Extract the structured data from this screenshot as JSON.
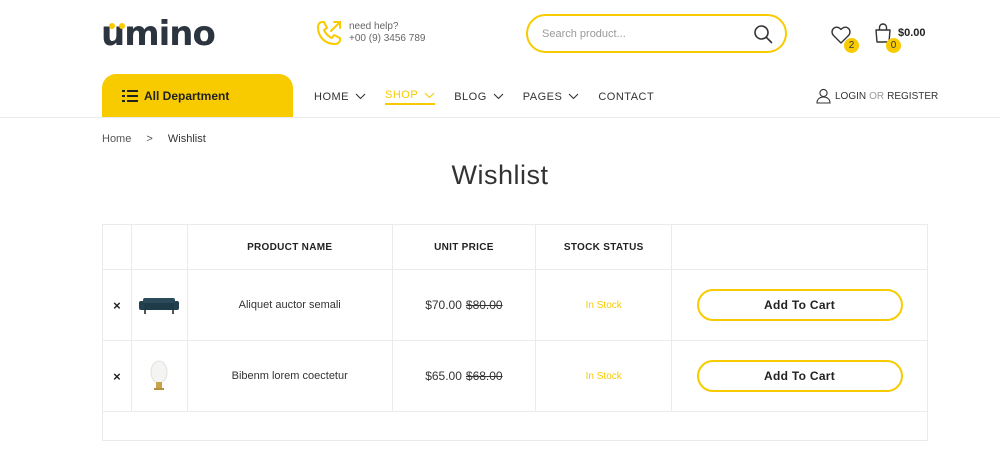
{
  "brand": {
    "logo": "umino"
  },
  "help": {
    "label": "need help?",
    "phone": "+00 (9) 3456 789"
  },
  "search": {
    "placeholder": "Search product..."
  },
  "header": {
    "wishlist_count": "2",
    "cart_count": "0",
    "cart_total": "$0.00"
  },
  "department": {
    "label": "All Department"
  },
  "nav": {
    "items": [
      {
        "label": "HOME"
      },
      {
        "label": "SHOP"
      },
      {
        "label": "BLOG"
      },
      {
        "label": "PAGES"
      },
      {
        "label": "CONTACT"
      }
    ]
  },
  "account": {
    "login": "LOGIN",
    "or": "OR",
    "register": "REGISTER"
  },
  "breadcrumb": {
    "home": "Home",
    "sep": ">",
    "current": "Wishlist"
  },
  "page": {
    "title": "Wishlist"
  },
  "table": {
    "headers": {
      "product": "PRODUCT NAME",
      "price": "UNIT PRICE",
      "stock": "STOCK STATUS"
    },
    "rows": [
      {
        "remove": "×",
        "name": "Aliquet auctor semali",
        "price": "$70.00",
        "old_price": "$80.00",
        "stock": "In Stock",
        "button": "Add To Cart",
        "thumb": "sofa"
      },
      {
        "remove": "×",
        "name": "Bibenm lorem coectetur",
        "price": "$65.00",
        "old_price": "$68.00",
        "stock": "In Stock",
        "button": "Add To Cart",
        "thumb": "lamp"
      }
    ]
  },
  "colors": {
    "accent": "#f8cb00",
    "text": "#333333",
    "border": "#ebebeb"
  }
}
